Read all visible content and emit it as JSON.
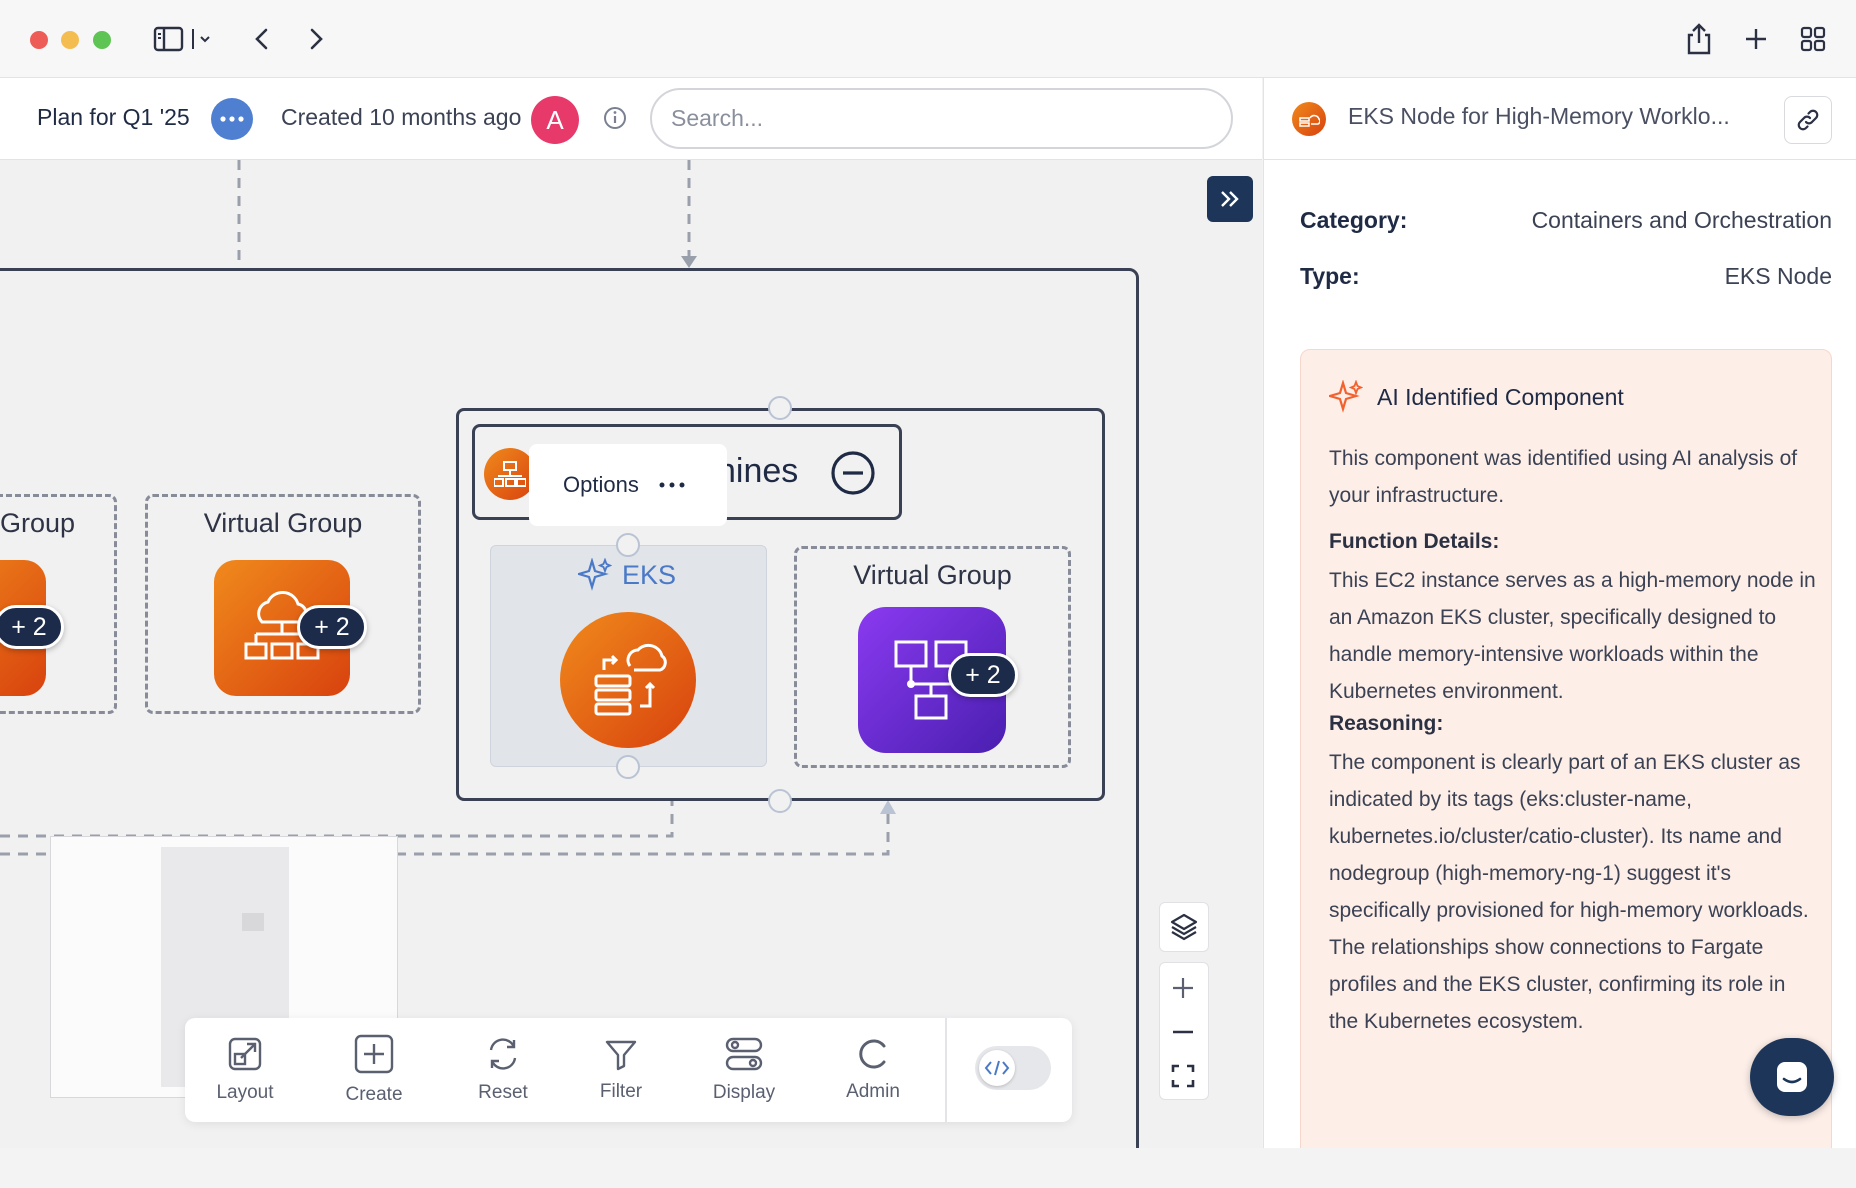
{
  "window": {
    "traffic_lights": [
      "#ee5c57",
      "#f3be4f",
      "#5ec453"
    ]
  },
  "header": {
    "plan_title": "Plan for Q1 '25",
    "created": "Created 10 months ago",
    "avatar_initial": "A",
    "search_placeholder": "Search..."
  },
  "panel": {
    "title": "EKS Node for High-Memory Worklo...",
    "category_label": "Category:",
    "category_value": "Containers and Orchestration",
    "type_label": "Type:",
    "type_value": "EKS Node",
    "ai_card": {
      "title": "AI Identified Component",
      "intro": "This component was identified using AI analysis of your infrastructure.",
      "function_heading": "Function Details:",
      "function_text": "This EC2 instance serves as a high-memory node in an Amazon EKS cluster, specifically designed to handle memory-intensive workloads within the Kubernetes environment.",
      "reasoning_heading": "Reasoning:",
      "reasoning_text": "The component is clearly part of an EKS cluster as indicated by its tags (eks:cluster-name, kubernetes.io/cluster/catio-cluster). Its name and nodegroup (high-memory-ng-1) suggest it's specifically provisioned for high-memory workloads. The relationships show connections to Fargate profiles and the EKS cluster, confirming its role in the Kubernetes ecosystem."
    }
  },
  "canvas": {
    "left_group_label": "Group",
    "left_group_badge": "+ 2",
    "virtual_group_1_label": "Virtual Group",
    "virtual_group_1_badge": "+ 2",
    "machines_header_text": "chines",
    "options_label": "Options",
    "eks_label": "EKS",
    "virtual_group_2_label": "Virtual Group",
    "virtual_group_2_badge": "+ 2"
  },
  "toolbar": {
    "items": [
      {
        "label": "Layout",
        "icon": "layout-icon"
      },
      {
        "label": "Create",
        "icon": "plus-square-icon"
      },
      {
        "label": "Reset",
        "icon": "refresh-icon"
      },
      {
        "label": "Filter",
        "icon": "filter-icon"
      },
      {
        "label": "Display",
        "icon": "toggles-icon"
      },
      {
        "label": "Admin",
        "icon": "spinner-icon"
      }
    ],
    "code_toggle_icon": "code-icon"
  },
  "colors": {
    "accent_navy": "#1c2b4a",
    "orange": "#e8681a",
    "purple": "#6a2bd9",
    "ai_card_bg": "#fdeee8",
    "avatar_pink": "#e8396b"
  }
}
